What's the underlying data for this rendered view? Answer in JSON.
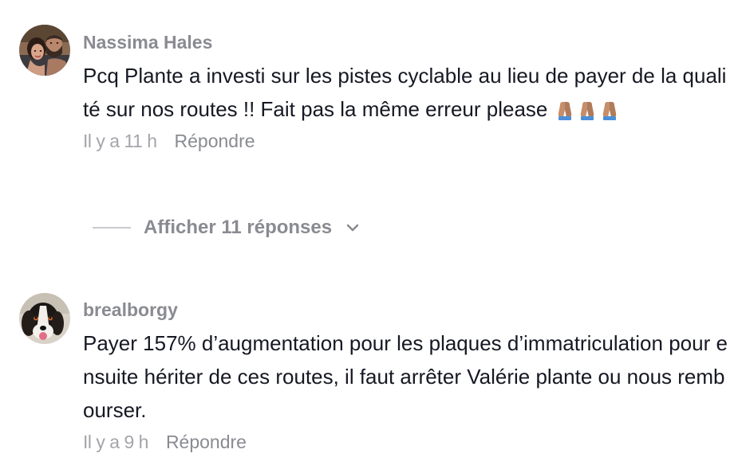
{
  "comments": [
    {
      "username": "Nassima Hales",
      "text_main": "Pcq Plante a investi sur les pistes cyclable au lieu de payer de la qualité sur nos routes !! Fait pas la même erreur please",
      "emojis": [
        "folded-hands-medium-skin-icon",
        "folded-hands-medium-skin-icon",
        "folded-hands-medium-skin-icon"
      ],
      "time": "Il y a 11 h",
      "reply_label": "Répondre"
    },
    {
      "username": "brealborgy",
      "text_main": "Payer 157% d’augmentation pour les plaques d’immatriculation pour ensuite hériter de ces routes, il faut arrêter Valérie plante ou nous rembourser.",
      "time": "Il y a 9 h",
      "reply_label": "Répondre"
    }
  ],
  "view_replies": {
    "label": "Afficher 11 réponses",
    "icon": "chevron-down-icon"
  },
  "colors": {
    "username": "#8a8b91",
    "text": "#161823",
    "time": "#a4a5aa",
    "divider": "#c9cacd",
    "emoji_skin": "#c68e6b",
    "emoji_sleeve": "#4a8fd8"
  }
}
